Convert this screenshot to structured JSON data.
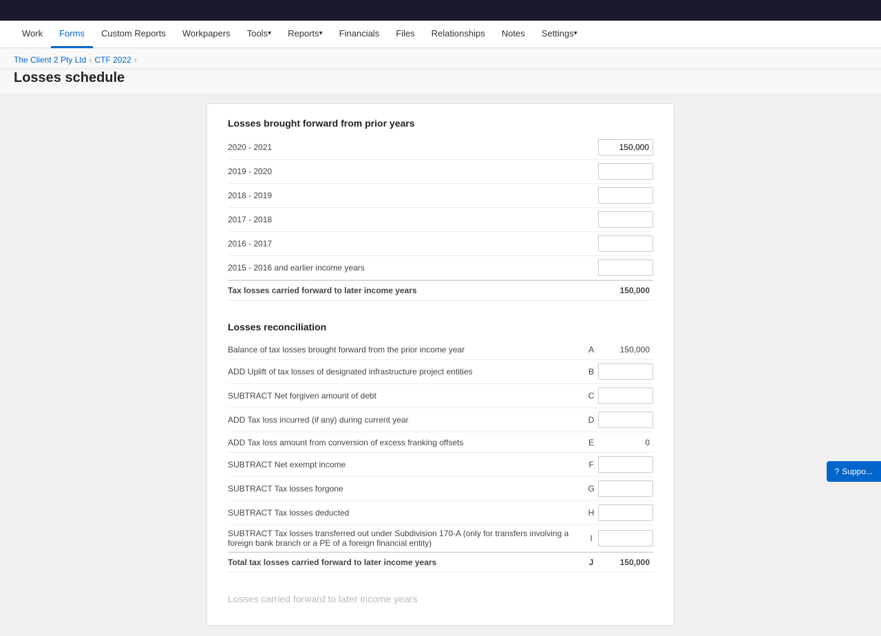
{
  "topbar": {},
  "nav": {
    "items": [
      {
        "label": "Work",
        "active": false,
        "hasArrow": false
      },
      {
        "label": "Forms",
        "active": true,
        "hasArrow": false
      },
      {
        "label": "Custom Reports",
        "active": false,
        "hasArrow": false
      },
      {
        "label": "Workpapers",
        "active": false,
        "hasArrow": false
      },
      {
        "label": "Tools",
        "active": false,
        "hasArrow": true
      },
      {
        "label": "Reports",
        "active": false,
        "hasArrow": true
      },
      {
        "label": "Financials",
        "active": false,
        "hasArrow": false
      },
      {
        "label": "Files",
        "active": false,
        "hasArrow": false
      },
      {
        "label": "Relationships",
        "active": false,
        "hasArrow": false
      },
      {
        "label": "Notes",
        "active": false,
        "hasArrow": false
      },
      {
        "label": "Settings",
        "active": false,
        "hasArrow": true
      }
    ]
  },
  "breadcrumb": {
    "client": "The Client 2 Pty Ltd",
    "period": "CTF 2022",
    "separator": "›"
  },
  "pageTitle": "Losses schedule",
  "sections": {
    "section1": {
      "heading": "Losses brought forward from prior years",
      "rows": [
        {
          "label": "2020 - 2021",
          "ref": "",
          "hasInput": true,
          "value": "150,000",
          "inputValue": "150,000"
        },
        {
          "label": "2019 - 2020",
          "ref": "",
          "hasInput": true,
          "value": "",
          "inputValue": ""
        },
        {
          "label": "2018 - 2019",
          "ref": "",
          "hasInput": true,
          "value": "",
          "inputValue": ""
        },
        {
          "label": "2017 - 2018",
          "ref": "",
          "hasInput": true,
          "value": "",
          "inputValue": ""
        },
        {
          "label": "2016 - 2017",
          "ref": "",
          "hasInput": true,
          "value": "",
          "inputValue": ""
        },
        {
          "label": "2015 - 2016 and earlier income years",
          "ref": "",
          "hasInput": true,
          "value": "",
          "inputValue": ""
        }
      ],
      "total": {
        "label": "Tax losses carried forward to later income years",
        "value": "150,000"
      }
    },
    "section2": {
      "heading": "Losses reconciliation",
      "rows": [
        {
          "label": "Balance of tax losses brought forward from the prior income year",
          "ref": "A",
          "hasInput": false,
          "value": "150,000"
        },
        {
          "label": "ADD Uplift of tax losses of designated infrastructure project entities",
          "ref": "B",
          "hasInput": true,
          "value": "",
          "inputValue": ""
        },
        {
          "label": "SUBTRACT Net forgiven amount of debt",
          "ref": "C",
          "hasInput": true,
          "value": "",
          "inputValue": ""
        },
        {
          "label": "ADD Tax loss incurred (if any) during current year",
          "ref": "D",
          "hasInput": true,
          "value": "",
          "inputValue": ""
        },
        {
          "label": "ADD Tax loss amount from conversion of excess franking offsets",
          "ref": "E",
          "hasInput": false,
          "value": "0"
        },
        {
          "label": "SUBTRACT Net exempt income",
          "ref": "F",
          "hasInput": true,
          "value": "",
          "inputValue": ""
        },
        {
          "label": "SUBTRACT Tax losses forgone",
          "ref": "G",
          "hasInput": true,
          "value": "",
          "inputValue": ""
        },
        {
          "label": "SUBTRACT Tax losses deducted",
          "ref": "H",
          "hasInput": true,
          "value": "",
          "inputValue": ""
        },
        {
          "label": "SUBTRACT Tax losses transferred out under Subdivision 170-A (only for transfers involving a foreign bank branch or a PE of a foreign financial entity)",
          "ref": "I",
          "hasInput": true,
          "value": "",
          "inputValue": ""
        }
      ],
      "total": {
        "label": "Total tax losses carried forward to later income years",
        "ref": "J",
        "value": "150,000"
      }
    },
    "section3": {
      "heading": "Losses carried forward to later income years"
    }
  },
  "support": {
    "label": "Suppo..."
  }
}
